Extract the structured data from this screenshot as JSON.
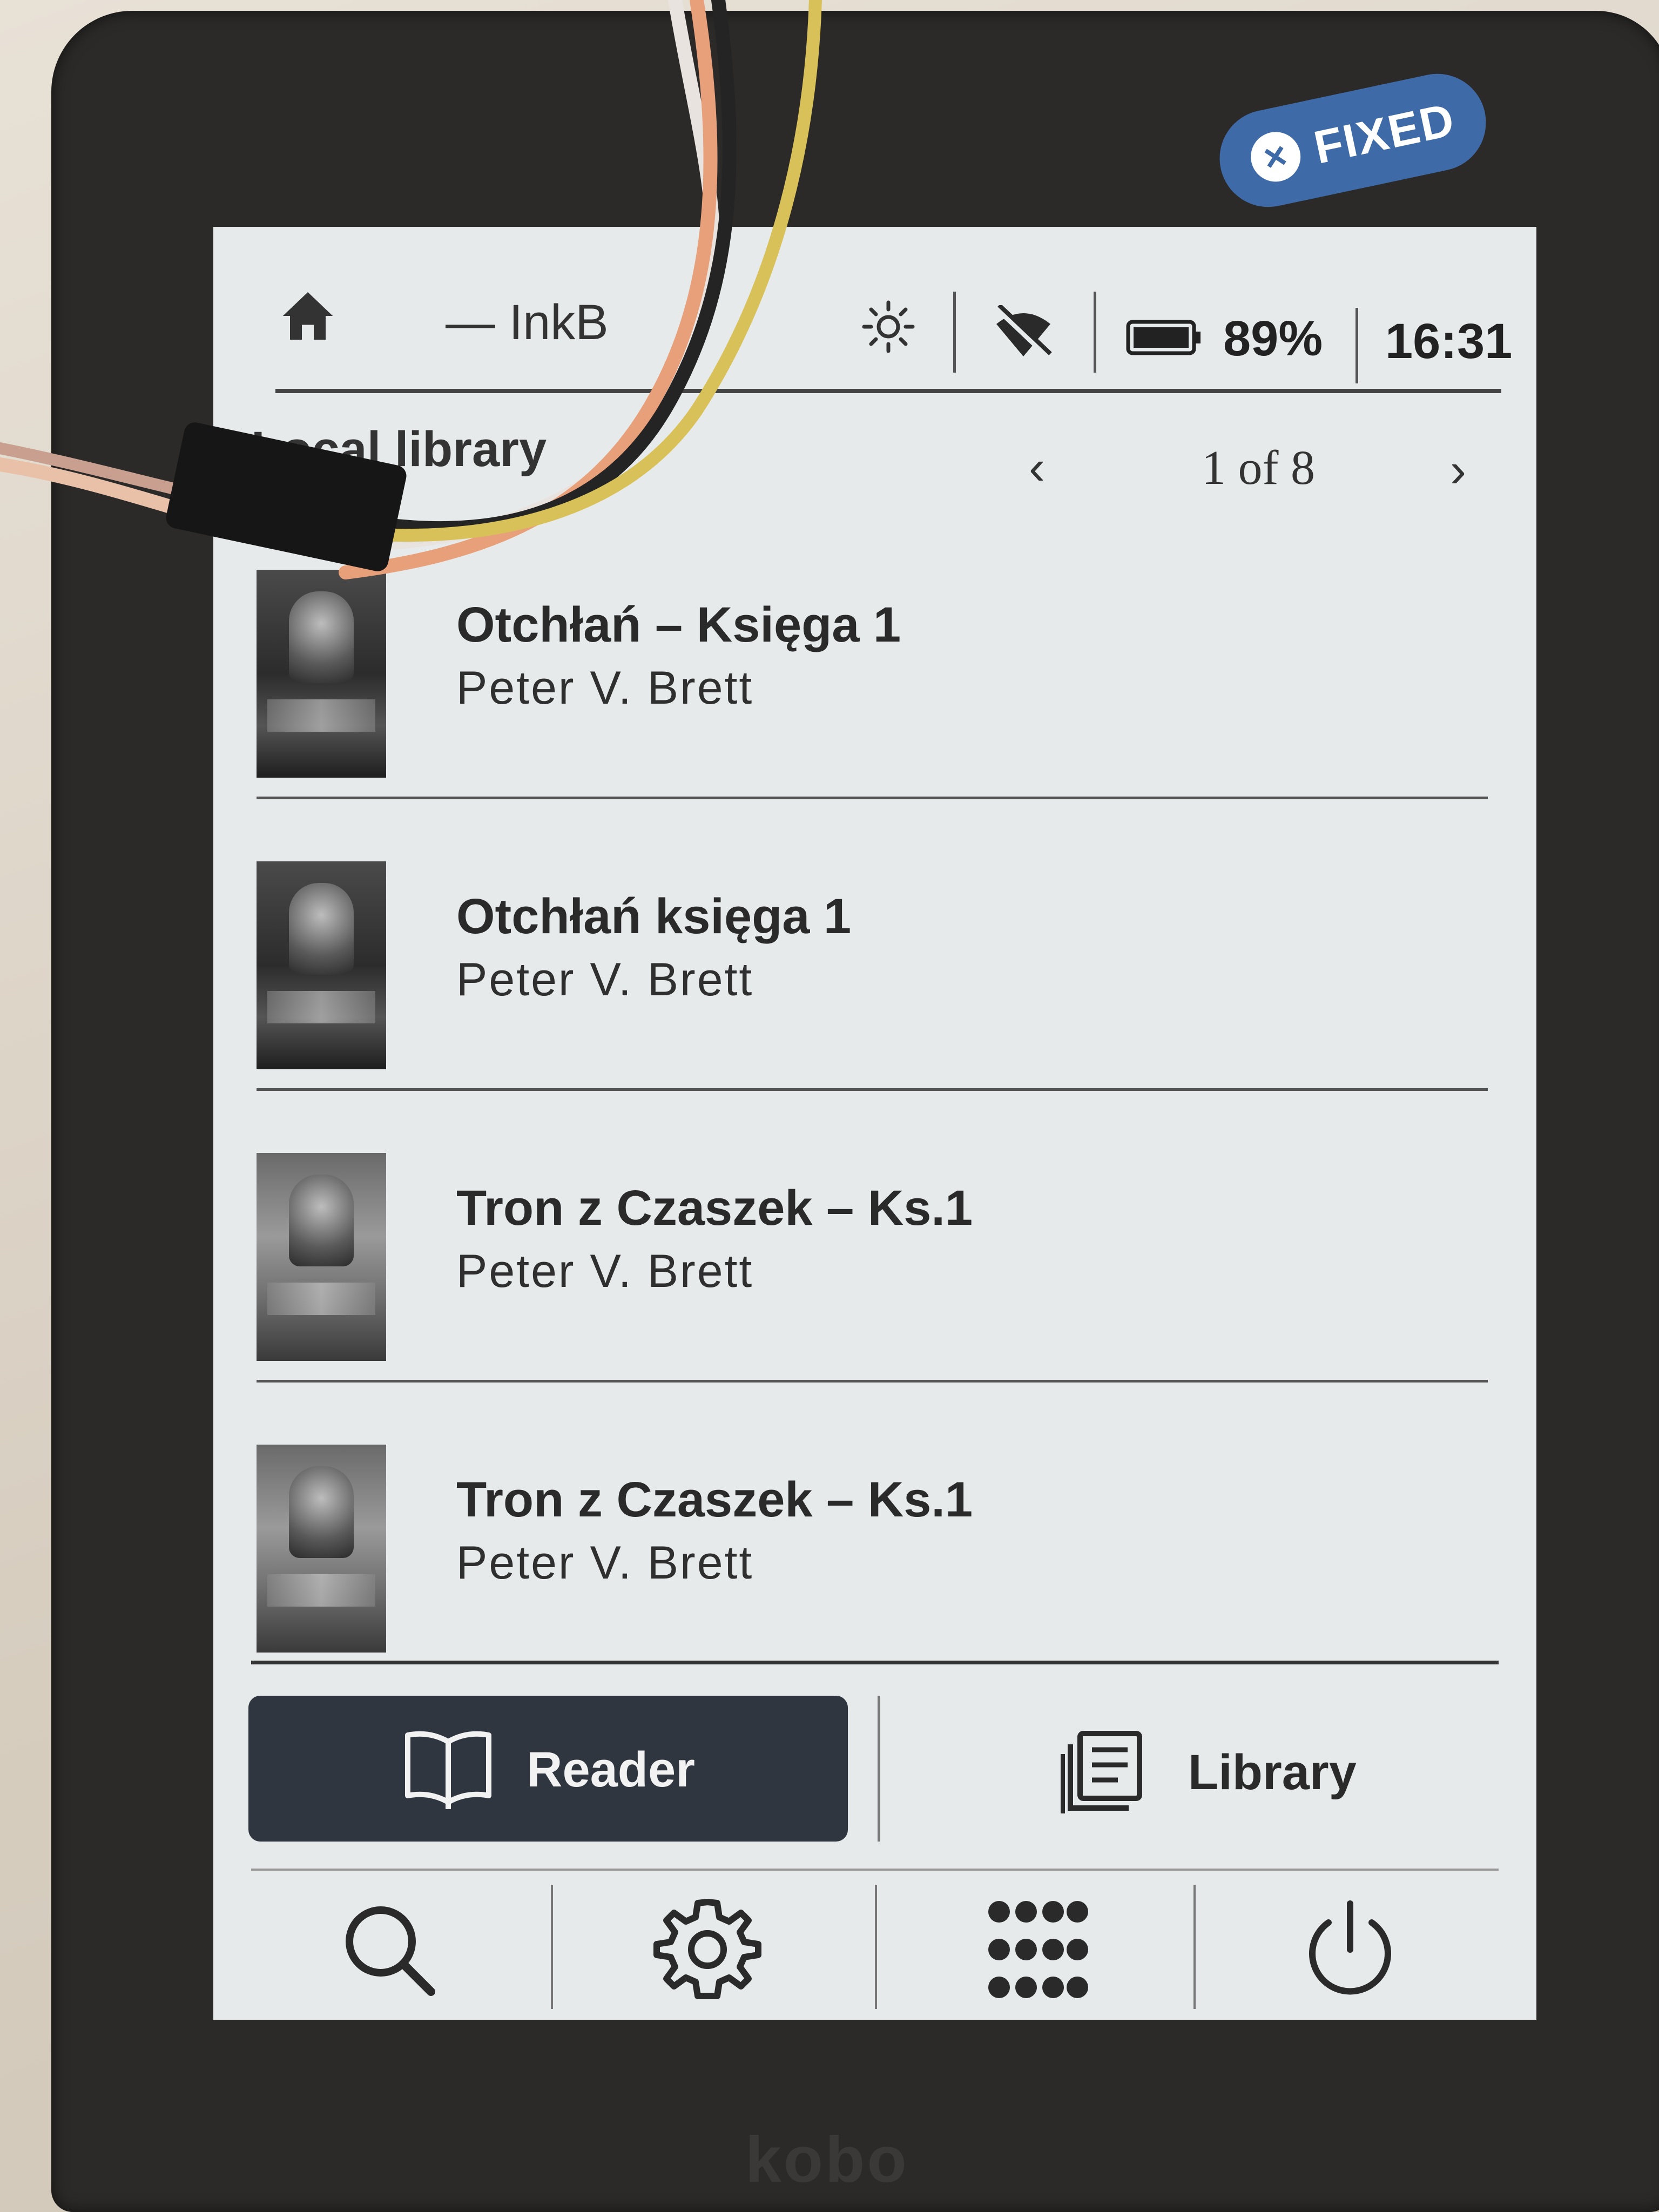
{
  "sticker": {
    "label": "FIXED",
    "close_glyph": "×"
  },
  "status_bar": {
    "app_title": "— InkB",
    "battery_percent": "89%",
    "time": "16:31",
    "icons": [
      "home-icon",
      "brightness-icon",
      "wifi-off-icon",
      "battery-icon"
    ]
  },
  "library": {
    "section_title": "Local library",
    "pager": {
      "prev": "‹",
      "label": "1 of 8",
      "next": "›"
    },
    "books": [
      {
        "title": "Otchłań – Księga 1",
        "author": "Peter V. Brett"
      },
      {
        "title": "Otchłań księga 1",
        "author": "Peter V. Brett"
      },
      {
        "title": "Tron z Czaszek – Ks.1",
        "author": "Peter V. Brett"
      },
      {
        "title": "Tron z Czaszek – Ks.1",
        "author": "Peter V. Brett"
      }
    ]
  },
  "tabs": {
    "reader": {
      "label": "Reader",
      "icon": "open-book-icon",
      "selected": true
    },
    "library": {
      "label": "Library",
      "icon": "library-stack-icon",
      "selected": false
    }
  },
  "toolbar": {
    "icons": [
      "search-icon",
      "gear-icon",
      "apps-grid-icon",
      "power-icon"
    ]
  },
  "colors": {
    "screen_bg": "#e7eaea",
    "selected_tab_bg": "#2f3640",
    "sticker_bg": "#3f6aa8",
    "device_bezel": "#2b2a29"
  }
}
